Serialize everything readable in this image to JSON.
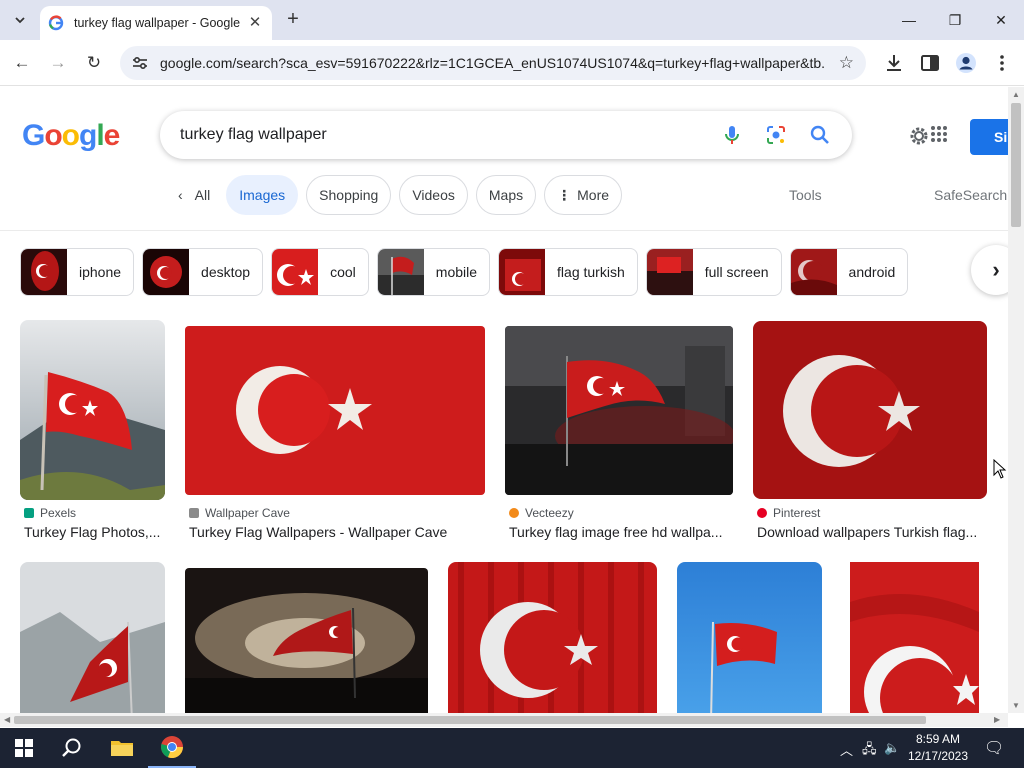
{
  "browser": {
    "tab_title": "turkey flag wallpaper - Google",
    "url": "google.com/search?sca_esv=591670222&rlz=1C1GCEA_enUS1074US1074&q=turkey+flag+wallpaper&tb..."
  },
  "google": {
    "logo": [
      "G",
      "o",
      "o",
      "g",
      "l",
      "e"
    ],
    "query": "turkey flag wallpaper",
    "signin_label": "Si",
    "nav_tabs": [
      {
        "label": "All"
      },
      {
        "label": "Images"
      },
      {
        "label": "Shopping"
      },
      {
        "label": "Videos"
      },
      {
        "label": "Maps"
      },
      {
        "label": "More"
      }
    ],
    "tools_label": "Tools",
    "safesearch_label": "SafeSearch",
    "chips": [
      {
        "label": "iphone"
      },
      {
        "label": "desktop"
      },
      {
        "label": "cool"
      },
      {
        "label": "mobile"
      },
      {
        "label": "flag turkish"
      },
      {
        "label": "full screen"
      },
      {
        "label": "android"
      }
    ],
    "results": [
      {
        "source": "Pexels",
        "title": "Turkey Flag Photos,..."
      },
      {
        "source": "Wallpaper Cave",
        "title": "Turkey Flag Wallpapers - Wallpaper Cave"
      },
      {
        "source": "Vecteezy",
        "title": "Turkey flag image free hd wallpa..."
      },
      {
        "source": "Pinterest",
        "title": "Download wallpapers Turkish flag..."
      }
    ]
  },
  "taskbar": {
    "time": "8:59 AM",
    "date": "12/17/2023"
  },
  "colors": {
    "flag_red": "#d81e1e",
    "google_blue": "#1a73e8",
    "chip_active_bg": "#e8f0fe",
    "taskbar": "#1c2333"
  }
}
